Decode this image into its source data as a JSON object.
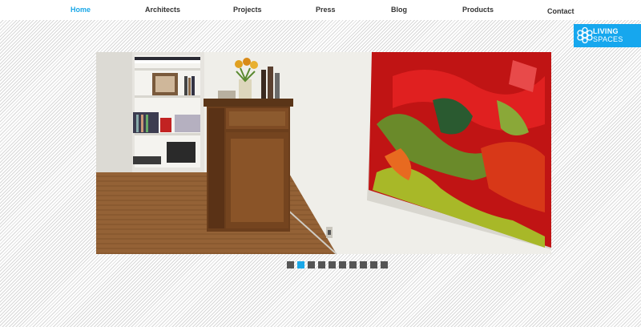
{
  "nav": {
    "items": [
      {
        "label": "Home",
        "active": true
      },
      {
        "label": "Architects",
        "active": false
      },
      {
        "label": "Projects",
        "active": false
      },
      {
        "label": "Press",
        "active": false
      },
      {
        "label": "Blog",
        "active": false
      },
      {
        "label": "Products",
        "active": false
      },
      {
        "label": "Contact",
        "active": false
      }
    ]
  },
  "logo": {
    "line1": "LIVING",
    "line2": "SPACES",
    "color": "#16a7ee"
  },
  "slideshow": {
    "slide_count": 10,
    "active_index": 1
  },
  "colors": {
    "accent": "#1aa8e8",
    "inactive_dot": "#555555"
  }
}
